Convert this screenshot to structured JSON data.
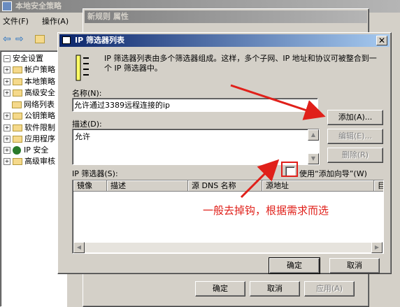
{
  "console": {
    "title": "本地安全策略",
    "menu": [
      "文件(F)",
      "操作(A)"
    ],
    "tree": [
      {
        "label": "安全设置",
        "expand": "−"
      },
      {
        "label": "帐户策略",
        "expand": "+"
      },
      {
        "label": "本地策略",
        "expand": "+"
      },
      {
        "label": "高级安全",
        "expand": "+"
      },
      {
        "label": "网络列表",
        "expand": ""
      },
      {
        "label": "公钥策略",
        "expand": "+"
      },
      {
        "label": "软件限制",
        "expand": "+"
      },
      {
        "label": "应用程序",
        "expand": "+"
      },
      {
        "label": "IP 安全",
        "expand": "+"
      },
      {
        "label": "高级审核",
        "expand": "+"
      }
    ]
  },
  "rule_props": {
    "title": "新规则 属性",
    "ok": "确定",
    "cancel": "取消",
    "apply": "应用(A)"
  },
  "dialog": {
    "title": "IP 筛选器列表",
    "description": "IP 筛选器列表由多个筛选器组成。这样，多个子网、IP 地址和协议可被整合到一个 IP 筛选器中。",
    "name_label": "名称(N):",
    "name_value": "允许通过3389远程连接的ip",
    "desc_label": "描述(D):",
    "desc_value": "允许",
    "add_button": "添加(A)...",
    "edit_button": "编辑(E)...",
    "delete_button": "删除(R)",
    "filters_label": "IP 筛选器(S):",
    "use_wizard_label": "使用“添加向导”(W)",
    "use_wizard_checked": false,
    "columns": [
      "镜像",
      "描述",
      "源 DNS 名称",
      "源地址",
      "目"
    ],
    "ok": "确定",
    "cancel": "取消"
  },
  "annotation": {
    "text": "一般去掉钩，根据需求而选",
    "color": "#e0201a"
  }
}
